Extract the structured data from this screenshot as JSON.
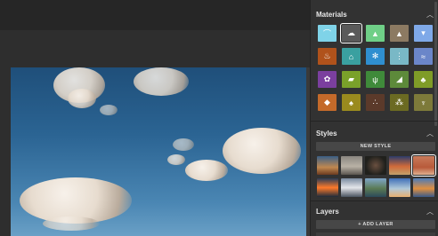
{
  "panel": {
    "materials": {
      "title": "Materials",
      "collapse_icon": "chevron-up-icon",
      "swatches": [
        {
          "icon": "sun-horizon-icon",
          "color": "#7fd3e8",
          "glyph": "⌒"
        },
        {
          "icon": "cloud-icon",
          "color": "#5a5a5a",
          "glyph": "☁",
          "selected": true
        },
        {
          "icon": "mountain-icon",
          "color": "#6fcf87",
          "glyph": "▲"
        },
        {
          "icon": "peak-icon",
          "color": "#8c7a62",
          "glyph": "▲"
        },
        {
          "icon": "drop-icon",
          "color": "#7fa9e8",
          "glyph": "▾"
        },
        {
          "icon": "fire-icon",
          "color": "#b0521b",
          "glyph": "♨"
        },
        {
          "icon": "house-icon",
          "color": "#3aa0a0",
          "glyph": "⌂"
        },
        {
          "icon": "snowflake-icon",
          "color": "#2f8fd0",
          "glyph": "✻"
        },
        {
          "icon": "rain-icon",
          "color": "#79b8c6",
          "glyph": "⋮"
        },
        {
          "icon": "waves-icon",
          "color": "#6b86c9",
          "glyph": "≈"
        },
        {
          "icon": "flower-icon",
          "color": "#7b3f9e",
          "glyph": "✿"
        },
        {
          "icon": "field-icon",
          "color": "#7aa12a",
          "glyph": "▰"
        },
        {
          "icon": "grass-icon",
          "color": "#3f8a3a",
          "glyph": "ψ"
        },
        {
          "icon": "hill-icon",
          "color": "#5d8a3a",
          "glyph": "◢"
        },
        {
          "icon": "forest-icon",
          "color": "#7f9c27",
          "glyph": "♣"
        },
        {
          "icon": "rock-icon",
          "color": "#c46a2a",
          "glyph": "◆"
        },
        {
          "icon": "palm-icon",
          "color": "#9a8a1e",
          "glyph": "♠"
        },
        {
          "icon": "stars-icon",
          "color": "#5b3a2a",
          "glyph": "∴"
        },
        {
          "icon": "sparkle-icon",
          "color": "#6b6a22",
          "glyph": "⁂"
        },
        {
          "icon": "tree-icon",
          "color": "#7d7a3a",
          "glyph": "♆"
        }
      ]
    },
    "styles": {
      "title": "Styles",
      "collapse_icon": "chevron-up-icon",
      "new_style_label": "NEW STYLE",
      "thumbs": [
        {
          "name": "style-canyon",
          "bg": "linear-gradient(180deg,#3a5f86 0%,#c08850 60%,#6b3a1f 100%)"
        },
        {
          "name": "style-sketch",
          "bg": "linear-gradient(180deg,#8a8680 0%,#b9b2a6 55%,#5b5650 100%)"
        },
        {
          "name": "style-dark-arch",
          "bg": "radial-gradient(circle at 50% 50%,#6a5040 0%,#20201c 70%)"
        },
        {
          "name": "style-sunset-sea",
          "bg": "linear-gradient(180deg,#2c3c6a 0%,#d06a3a 55%,#c3a06a 100%)"
        },
        {
          "name": "style-desert",
          "bg": "linear-gradient(180deg,#c87a5a 0%,#b85a3a 60%,#e0b090 100%)",
          "selected": true
        },
        {
          "name": "style-ocean-dusk",
          "bg": "linear-gradient(180deg,#2a3b55 0%,#ff7a2a 50%,#1c2a3a 100%)"
        },
        {
          "name": "style-snow-peaks",
          "bg": "linear-gradient(180deg,#7a8aa0 0%,#e4e6ea 50%,#4a5460 100%)"
        },
        {
          "name": "style-mountain-lake",
          "bg": "linear-gradient(180deg,#7fa6c8 0%,#5a7a54 55%,#2c4a5a 100%)"
        },
        {
          "name": "style-coast",
          "bg": "linear-gradient(180deg,#3f6fb8 0%,#b0c8d8 55%,#e8b070 100%)"
        },
        {
          "name": "style-valley",
          "bg": "linear-gradient(180deg,#4a7ab8 0%,#e09040 55%,#3a5a8a 100%)"
        }
      ]
    },
    "layers": {
      "title": "Layers",
      "collapse_icon": "chevron-up-icon",
      "add_layer_label": "+ ADD LAYER"
    }
  }
}
